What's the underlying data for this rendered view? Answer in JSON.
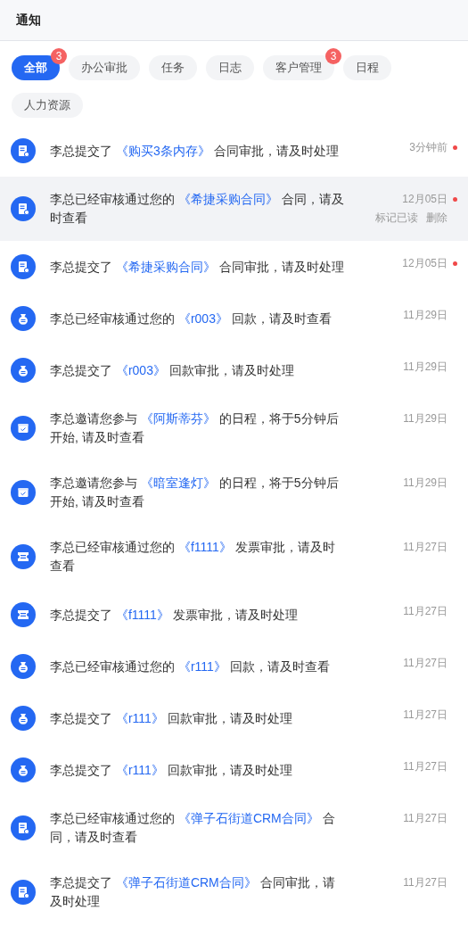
{
  "header": {
    "title": "通知"
  },
  "tabs": [
    {
      "label": "全部",
      "selected": true,
      "badge": "3"
    },
    {
      "label": "办公审批",
      "selected": false
    },
    {
      "label": "任务",
      "selected": false
    },
    {
      "label": "日志",
      "selected": false
    },
    {
      "label": "客户管理",
      "selected": false,
      "badge": "3"
    },
    {
      "label": "日程",
      "selected": false
    },
    {
      "label": "人力资源",
      "selected": false
    }
  ],
  "notifications": [
    {
      "kind": "contract",
      "prefix": "李总提交了",
      "link": "《购买3条内存》",
      "suffix": "合同审批，请及时处理",
      "time": "3分钟前",
      "unread": true,
      "selected": false
    },
    {
      "kind": "contract",
      "prefix": "李总已经审核通过您的",
      "link": "《希捷采购合同》",
      "suffix": "合同，请及时查看",
      "time": "12月05日",
      "unread": true,
      "selected": true,
      "actions": [
        "标记已读",
        "删除"
      ]
    },
    {
      "kind": "contract",
      "prefix": "李总提交了",
      "link": "《希捷采购合同》",
      "suffix": "合同审批，请及时处理",
      "time": "12月05日",
      "unread": true,
      "selected": false
    },
    {
      "kind": "payment",
      "prefix": "李总已经审核通过您的",
      "link": "《r003》",
      "suffix": "回款，请及时查看",
      "time": "11月29日",
      "unread": false,
      "selected": false
    },
    {
      "kind": "payment",
      "prefix": "李总提交了",
      "link": "《r003》",
      "suffix": "回款审批，请及时处理",
      "time": "11月29日",
      "unread": false,
      "selected": false
    },
    {
      "kind": "schedule",
      "prefix": "李总邀请您参与",
      "link": "《阿斯蒂芬》",
      "suffix": "的日程，将于5分钟后开始, 请及时查看",
      "time": "11月29日",
      "unread": false,
      "selected": false
    },
    {
      "kind": "schedule",
      "prefix": "李总邀请您参与",
      "link": "《暗室逢灯》",
      "suffix": "的日程，将于5分钟后开始, 请及时查看",
      "time": "11月29日",
      "unread": false,
      "selected": false
    },
    {
      "kind": "invoice",
      "prefix": "李总已经审核通过您的",
      "link": "《f1111》",
      "suffix": "发票审批，请及时查看",
      "time": "11月27日",
      "unread": false,
      "selected": false
    },
    {
      "kind": "invoice",
      "prefix": "李总提交了",
      "link": "《f1111》",
      "suffix": "发票审批，请及时处理",
      "time": "11月27日",
      "unread": false,
      "selected": false
    },
    {
      "kind": "payment",
      "prefix": "李总已经审核通过您的",
      "link": "《r111》",
      "suffix": "回款，请及时查看",
      "time": "11月27日",
      "unread": false,
      "selected": false
    },
    {
      "kind": "payment",
      "prefix": "李总提交了",
      "link": "《r111》",
      "suffix": "回款审批，请及时处理",
      "time": "11月27日",
      "unread": false,
      "selected": false
    },
    {
      "kind": "payment",
      "prefix": "李总提交了",
      "link": "《r111》",
      "suffix": "回款审批，请及时处理",
      "time": "11月27日",
      "unread": false,
      "selected": false
    },
    {
      "kind": "contract",
      "prefix": "李总已经审核通过您的",
      "link": "《弹子石街道CRM合同》",
      "suffix": "合同，请及时查看",
      "time": "11月27日",
      "unread": false,
      "selected": false
    },
    {
      "kind": "contract",
      "prefix": "李总提交了",
      "link": "《弹子石街道CRM合同》",
      "suffix": "合同审批，请及时处理",
      "time": "11月27日",
      "unread": false,
      "selected": false
    }
  ]
}
